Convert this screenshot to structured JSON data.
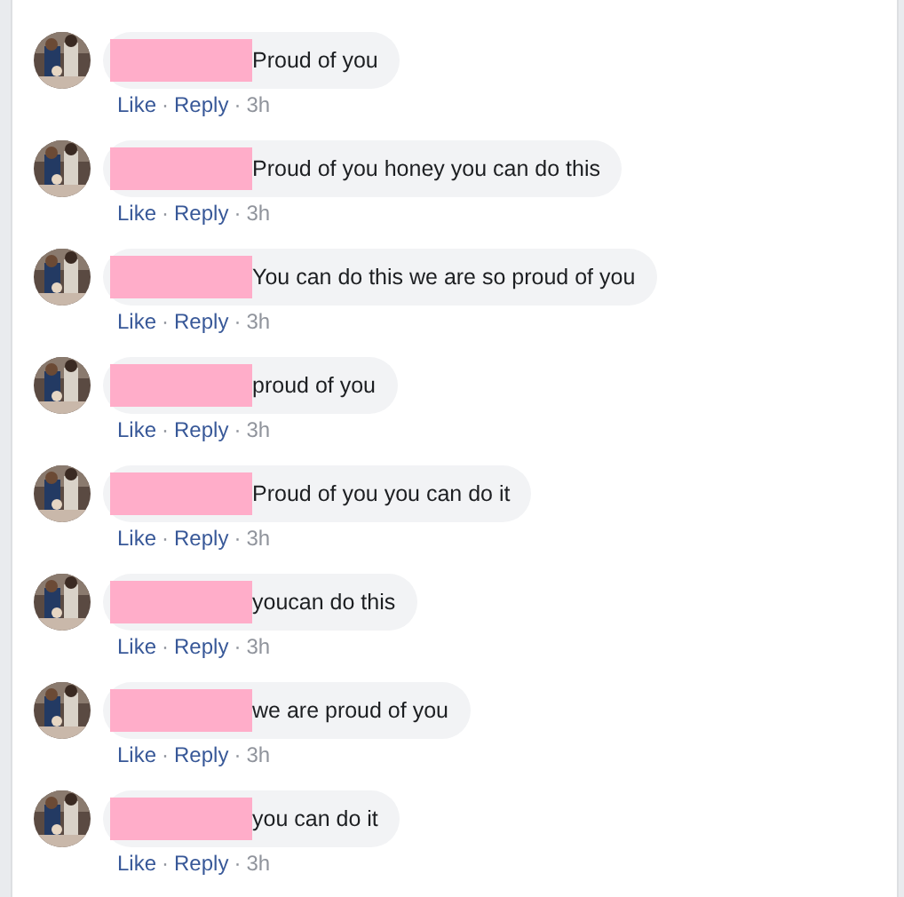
{
  "comments": [
    {
      "text": "Proud of you",
      "meta": [
        {
          "kind": "link",
          "text": "Like"
        },
        {
          "kind": "sep",
          "text": "·"
        },
        {
          "kind": "link",
          "text": "Reply"
        },
        {
          "kind": "sep",
          "text": "·"
        },
        {
          "kind": "time",
          "text": "3h"
        }
      ]
    },
    {
      "text": "Proud of you honey you can do this",
      "meta": [
        {
          "kind": "link",
          "text": "Like"
        },
        {
          "kind": "sep",
          "text": "·"
        },
        {
          "kind": "link",
          "text": "Reply"
        },
        {
          "kind": "sep",
          "text": "·"
        },
        {
          "kind": "time",
          "text": "3h"
        }
      ]
    },
    {
      "text": "You can do this we are so proud of you",
      "meta": [
        {
          "kind": "link",
          "text": "Like"
        },
        {
          "kind": "sep",
          "text": "·"
        },
        {
          "kind": "link",
          "text": "Reply"
        },
        {
          "kind": "sep",
          "text": "·"
        },
        {
          "kind": "time",
          "text": "3h"
        }
      ]
    },
    {
      "text": "proud of you",
      "meta": [
        {
          "kind": "link",
          "text": "Like"
        },
        {
          "kind": "sep",
          "text": "·"
        },
        {
          "kind": "link",
          "text": "Reply"
        },
        {
          "kind": "sep",
          "text": "·"
        },
        {
          "kind": "time",
          "text": "3h"
        }
      ]
    },
    {
      "text": "Proud of you you can do it",
      "meta": [
        {
          "kind": "link",
          "text": "Like"
        },
        {
          "kind": "sep",
          "text": "·"
        },
        {
          "kind": "link",
          "text": "Reply"
        },
        {
          "kind": "sep",
          "text": "·"
        },
        {
          "kind": "time",
          "text": "3h"
        }
      ]
    },
    {
      "text": "youcan do this",
      "meta": [
        {
          "kind": "link",
          "text": "Like"
        },
        {
          "kind": "sep",
          "text": "·"
        },
        {
          "kind": "link",
          "text": "Reply"
        },
        {
          "kind": "sep",
          "text": "·"
        },
        {
          "kind": "time",
          "text": "3h"
        }
      ]
    },
    {
      "text": "we are proud of you",
      "meta": [
        {
          "kind": "link",
          "text": "Like"
        },
        {
          "kind": "sep",
          "text": "·"
        },
        {
          "kind": "link",
          "text": "Reply"
        },
        {
          "kind": "sep",
          "text": "·"
        },
        {
          "kind": "time",
          "text": "3h"
        }
      ]
    },
    {
      "text": "you can do it",
      "meta": [
        {
          "kind": "link",
          "text": "Like"
        },
        {
          "kind": "sep",
          "text": "·"
        },
        {
          "kind": "link",
          "text": "Reply"
        },
        {
          "kind": "sep",
          "text": "·"
        },
        {
          "kind": "time",
          "text": "3h"
        }
      ]
    }
  ]
}
